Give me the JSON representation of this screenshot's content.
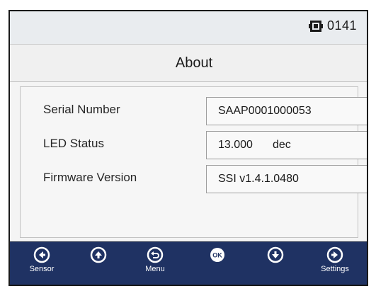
{
  "status": {
    "clock": "0141",
    "icon": "device-status-icon"
  },
  "header": {
    "title": "About"
  },
  "info": {
    "rows": [
      {
        "label": "Serial Number",
        "value": "SAAP0001000053",
        "unit": ""
      },
      {
        "label": "LED Status",
        "value": "13.000",
        "unit": "dec"
      },
      {
        "label": "Firmware Version",
        "value": "SSI v1.4.1.0480",
        "unit": ""
      }
    ]
  },
  "nav": {
    "buttons": [
      {
        "icon": "arrow-left-icon",
        "label": "Sensor"
      },
      {
        "icon": "arrow-up-icon",
        "label": ""
      },
      {
        "icon": "back-icon",
        "label": "Menu"
      },
      {
        "icon": "ok-icon",
        "label": ""
      },
      {
        "icon": "arrow-down-icon",
        "label": ""
      },
      {
        "icon": "arrow-right-icon",
        "label": "Settings"
      }
    ]
  },
  "colors": {
    "nav_background": "#1f3263",
    "screen_background": "#f4f4f4"
  }
}
